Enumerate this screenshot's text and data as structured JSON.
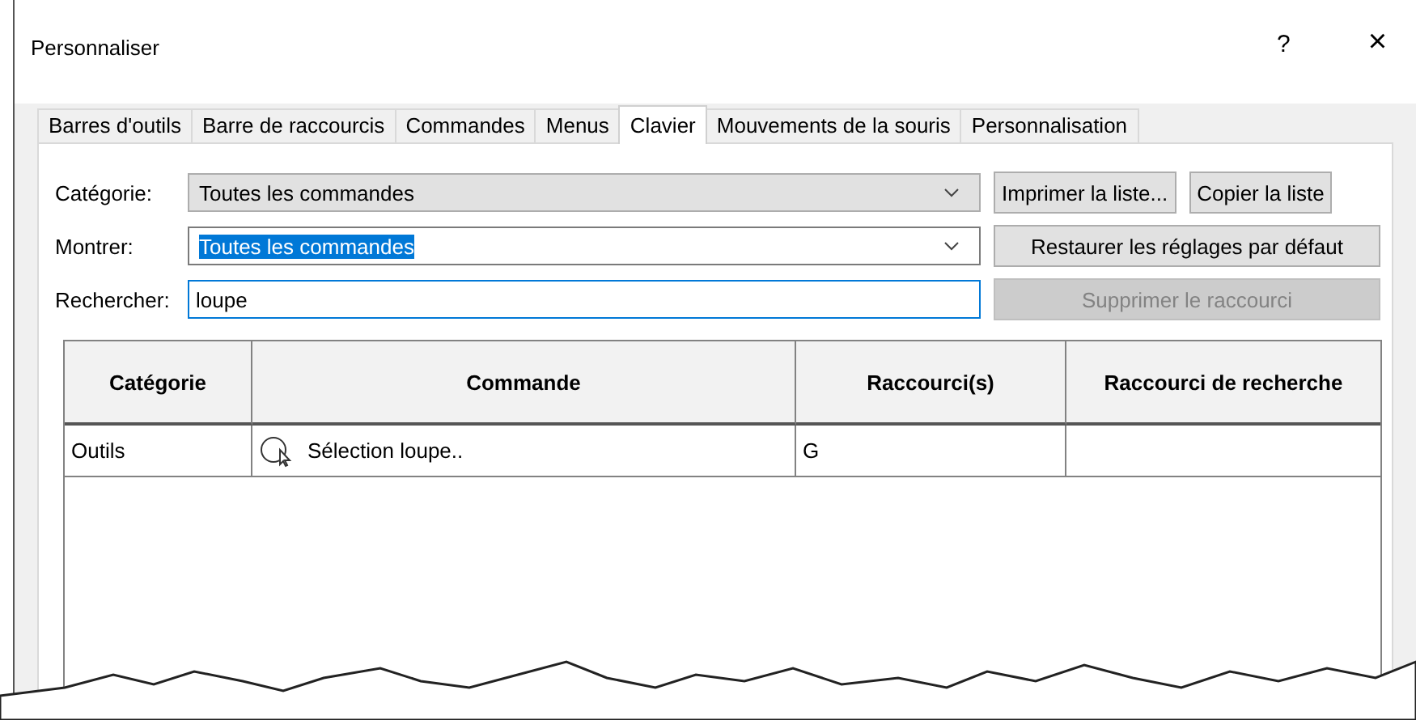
{
  "window": {
    "title": "Personnaliser",
    "help": "?",
    "close": "×"
  },
  "tabs": [
    {
      "label": "Barres d'outils",
      "selected": false
    },
    {
      "label": "Barre de raccourcis",
      "selected": false
    },
    {
      "label": "Commandes",
      "selected": false
    },
    {
      "label": "Menus",
      "selected": false
    },
    {
      "label": "Clavier",
      "selected": true
    },
    {
      "label": "Mouvements de la souris",
      "selected": false
    },
    {
      "label": "Personnalisation",
      "selected": false
    }
  ],
  "category": {
    "label": "Catégorie:",
    "value": "Toutes les commandes",
    "text_selected": false
  },
  "show": {
    "label": "Montrer:",
    "value": "Toutes les commandes",
    "text_selected": true
  },
  "search": {
    "label": "Rechercher:",
    "value": "loupe"
  },
  "buttons": [
    {
      "label": "Imprimer la liste...",
      "disabled": false
    },
    {
      "label": "Copier la liste",
      "disabled": false
    },
    {
      "label": "Restaurer les réglages par défaut",
      "disabled": false
    },
    {
      "label": "Supprimer le raccourci",
      "disabled": true
    }
  ],
  "table": {
    "columns": [
      "Catégorie",
      "Commande",
      "Raccourci(s)",
      "Raccourci de recherche"
    ],
    "rows": [
      {
        "category": "Outils",
        "command": "Sélection loupe..",
        "shortcuts": "G",
        "search_shortcut": ""
      }
    ]
  }
}
